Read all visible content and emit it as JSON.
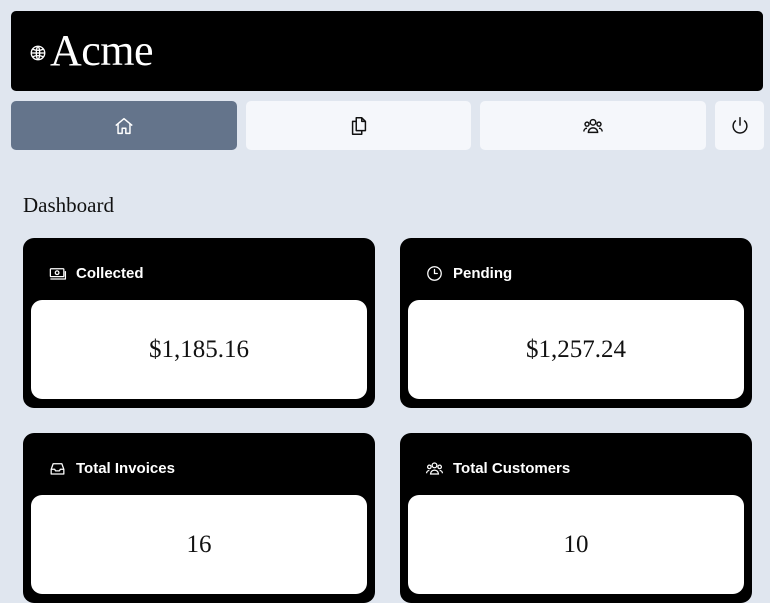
{
  "header": {
    "brand": "Acme",
    "logo_icon": "globe-icon"
  },
  "nav": [
    {
      "name": "home",
      "icon": "home-icon",
      "active": true
    },
    {
      "name": "invoices",
      "icon": "documents-icon",
      "active": false
    },
    {
      "name": "customers",
      "icon": "users-icon",
      "active": false
    },
    {
      "name": "sign-out",
      "icon": "power-icon",
      "active": false
    }
  ],
  "page": {
    "title": "Dashboard"
  },
  "cards": {
    "collected": {
      "label": "Collected",
      "value": "$1,185.16",
      "icon": "banknotes-icon"
    },
    "pending": {
      "label": "Pending",
      "value": "$1,257.24",
      "icon": "clock-icon"
    },
    "total_invoices": {
      "label": "Total Invoices",
      "value": "16",
      "icon": "inbox-icon"
    },
    "total_customers": {
      "label": "Total Customers",
      "value": "10",
      "icon": "users-icon"
    }
  },
  "colors": {
    "background": "#e0e6ef",
    "active_nav": "#64748b",
    "card": "#000000"
  }
}
